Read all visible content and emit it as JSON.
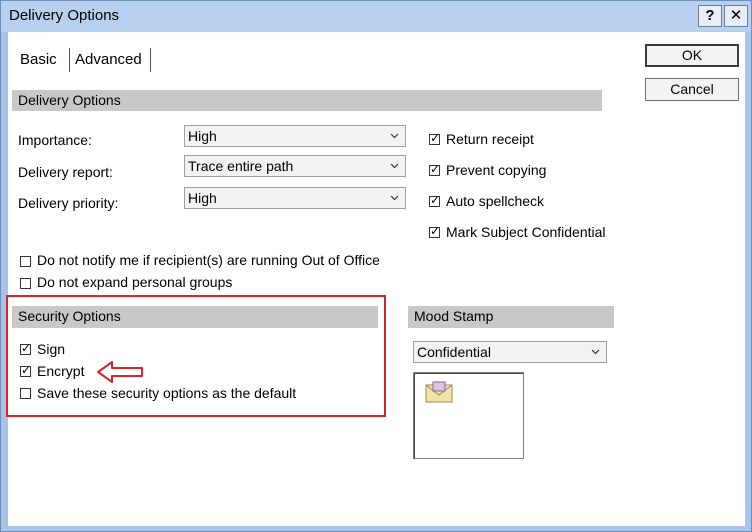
{
  "window": {
    "title": "Delivery Options",
    "help_glyph": "?",
    "close_glyph": "✕"
  },
  "tabs": [
    {
      "label": "Basic"
    },
    {
      "label": "Advanced"
    }
  ],
  "buttons": {
    "ok": "OK",
    "cancel": "Cancel"
  },
  "delivery": {
    "header": "Delivery Options",
    "importance": {
      "label": "Importance:",
      "value": "High"
    },
    "report": {
      "label": "Delivery report:",
      "value": "Trace entire path"
    },
    "priority": {
      "label": "Delivery priority:",
      "value": "High"
    },
    "checks": [
      {
        "label": "Return receipt",
        "checked": true
      },
      {
        "label": "Prevent copying",
        "checked": true
      },
      {
        "label": "Auto spellcheck",
        "checked": true
      },
      {
        "label": "Mark Subject Confidential",
        "checked": true
      }
    ],
    "options": [
      {
        "label": "Do not notify me if recipient(s) are running Out of Office",
        "checked": false
      },
      {
        "label": "Do not expand personal groups",
        "checked": false
      }
    ]
  },
  "security": {
    "header": "Security Options",
    "items": [
      {
        "label": "Sign",
        "checked": true
      },
      {
        "label": "Encrypt",
        "checked": true
      },
      {
        "label": "Save these security options as the default",
        "checked": false
      }
    ]
  },
  "mood": {
    "header": "Mood Stamp",
    "value": "Confidential",
    "icon": "envelope-stamp-icon"
  },
  "colors": {
    "highlight": "#d9242c",
    "section_header": "#c8c8c8",
    "title_bar": "#b8d0ef"
  }
}
